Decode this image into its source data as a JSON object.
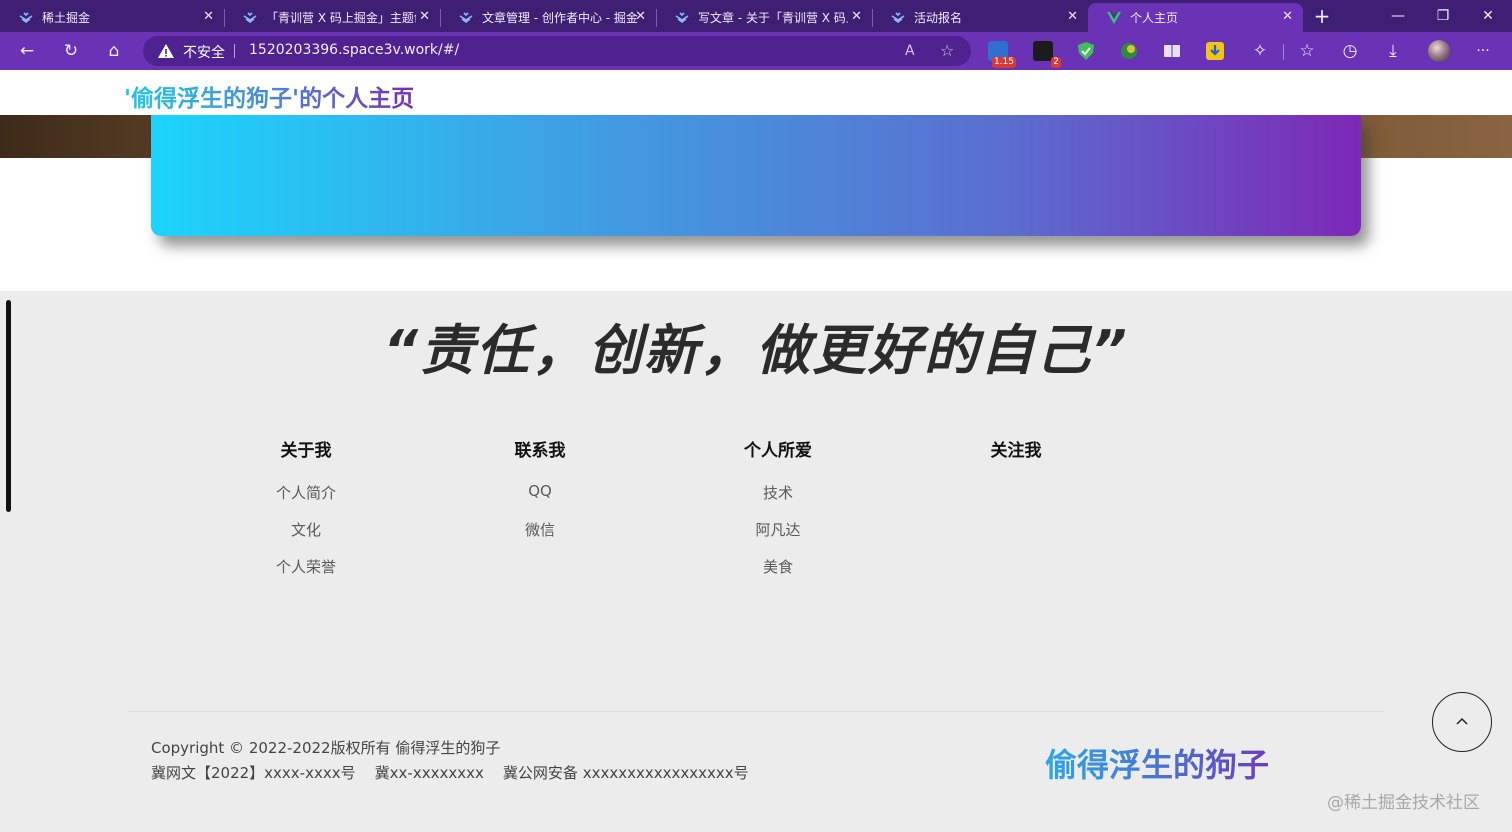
{
  "browser": {
    "tabs": [
      {
        "title": "稀土掘金",
        "active": false
      },
      {
        "title": "「青训营 X 码上掘金」主题创",
        "active": false
      },
      {
        "title": "文章管理 - 创作者中心 - 掘金",
        "active": false
      },
      {
        "title": "写文章 - 关于「青训营 X 码上",
        "active": false
      },
      {
        "title": "活动报名",
        "active": false
      },
      {
        "title": "个人主页",
        "active": true
      }
    ],
    "new_tab": "+",
    "insecure_label": "不安全",
    "url": "1520203396.space3v.work/#/",
    "extensions": {
      "badge_1": "1.15",
      "badge_2": "2"
    }
  },
  "page": {
    "site_title": "'偷得浮生的狗子'的个人主页",
    "motto": "“责任，创新，做更好的自己”",
    "footer_columns": [
      {
        "title": "关于我",
        "links": [
          "个人简介",
          "文化",
          "个人荣誉"
        ]
      },
      {
        "title": "联系我",
        "links": [
          "QQ",
          "微信"
        ]
      },
      {
        "title": "个人所爱",
        "links": [
          "技术",
          "阿凡达",
          "美食"
        ]
      },
      {
        "title": "关注我",
        "links": []
      }
    ],
    "copyright_line1": "Copyright © 2022-2022版权所有 偷得浮生的狗子",
    "copyright_line2": "冀网文【2022】xxxx-xxxx号    冀xx-xxxxxxxx    冀公网安备 xxxxxxxxxxxxxxxxx号",
    "footer_brand": "偷得浮生的狗子",
    "back_to_top_icon": "chevron-up-icon",
    "watermark": "@稀土掘金技术社区"
  },
  "colors": {
    "tabbar": "#3f1f74",
    "navbar": "#6a32b4",
    "banner_start": "#1cd4fb",
    "banner_end": "#7d28b8",
    "footer_bg": "#ececec"
  }
}
